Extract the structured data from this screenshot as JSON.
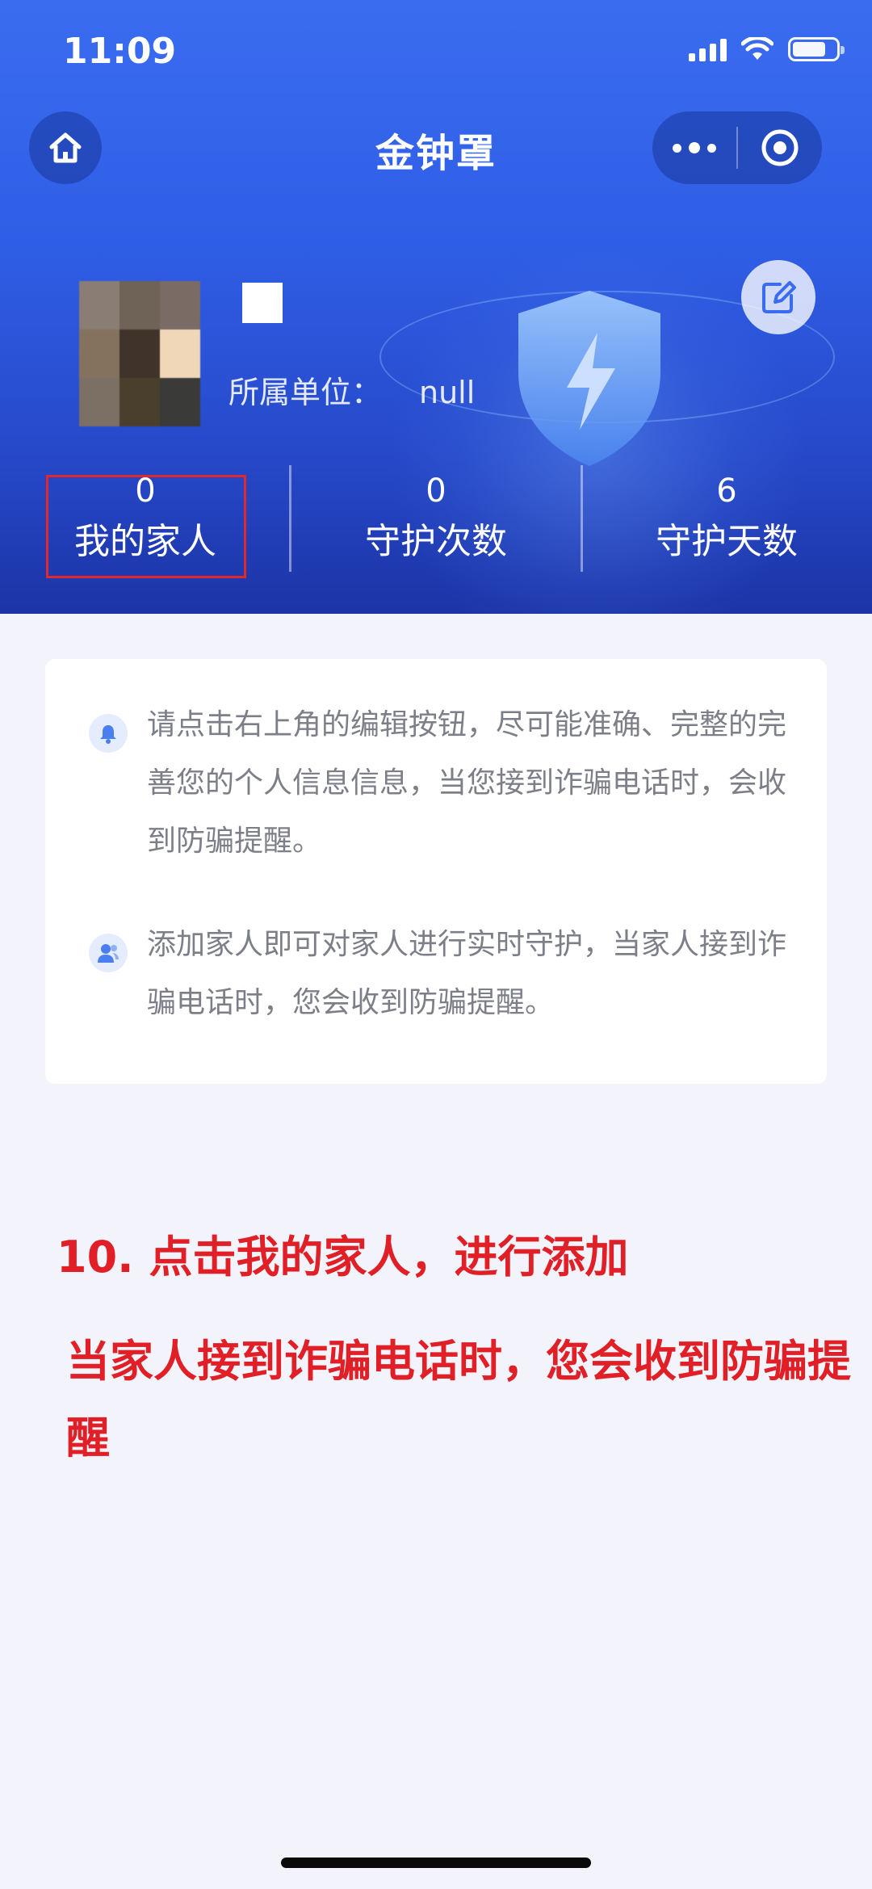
{
  "status_bar": {
    "time": "11:09"
  },
  "nav": {
    "title": "金钟罩"
  },
  "profile": {
    "org_label": "所属单位：",
    "org_value": "null"
  },
  "stats": [
    {
      "value": "0",
      "label": "我的家人"
    },
    {
      "value": "0",
      "label": "守护次数"
    },
    {
      "value": "6",
      "label": "守护天数"
    }
  ],
  "tips": [
    {
      "icon": "bell-icon",
      "text": "请点击右上角的编辑按钮，尽可能准确、完整的完善您的个人信息信息，当您接到诈骗电话时，会收到防骗提醒。"
    },
    {
      "icon": "family-icon",
      "text": "添加家人即可对家人进行实时守护，当家人接到诈骗电话时，您会收到防骗提醒。"
    }
  ],
  "annotations": {
    "step": "10. 点击我的家人，进行添加",
    "note": "当家人接到诈骗电话时，您会收到防骗提醒"
  },
  "colors": {
    "brand": "#2f5ee6",
    "annotation_red": "#e01f26",
    "highlight_box": "#e5262a",
    "page_bg": "#f2f3fb"
  }
}
